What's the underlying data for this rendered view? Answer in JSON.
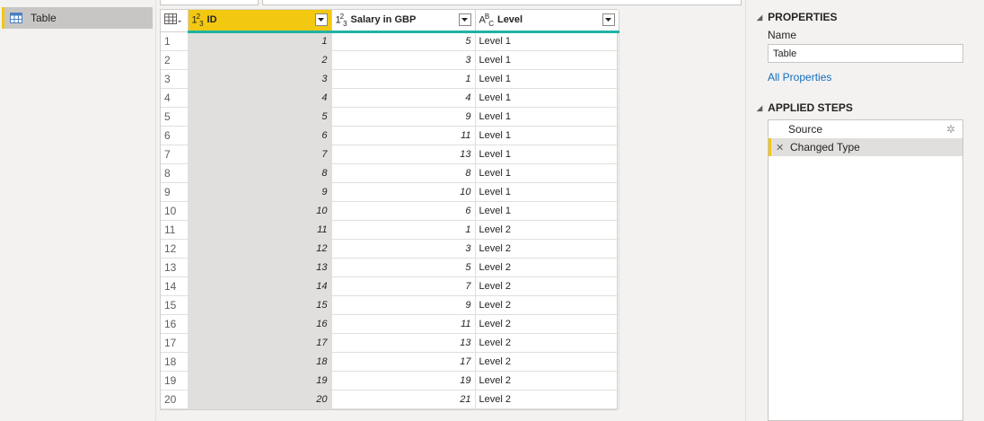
{
  "queries": {
    "items": [
      {
        "label": "Table"
      }
    ]
  },
  "grid": {
    "columns": [
      {
        "label": "ID",
        "type_icon": "whole-number-icon"
      },
      {
        "label": "Salary in GBP",
        "type_icon": "whole-number-icon"
      },
      {
        "label": "Level",
        "type_icon": "text-type-icon"
      }
    ],
    "rows": [
      {
        "n": "1",
        "id": "1",
        "salary": "5",
        "level": "Level 1"
      },
      {
        "n": "2",
        "id": "2",
        "salary": "3",
        "level": "Level 1"
      },
      {
        "n": "3",
        "id": "3",
        "salary": "1",
        "level": "Level 1"
      },
      {
        "n": "4",
        "id": "4",
        "salary": "4",
        "level": "Level 1"
      },
      {
        "n": "5",
        "id": "5",
        "salary": "9",
        "level": "Level 1"
      },
      {
        "n": "6",
        "id": "6",
        "salary": "11",
        "level": "Level 1"
      },
      {
        "n": "7",
        "id": "7",
        "salary": "13",
        "level": "Level 1"
      },
      {
        "n": "8",
        "id": "8",
        "salary": "8",
        "level": "Level 1"
      },
      {
        "n": "9",
        "id": "9",
        "salary": "10",
        "level": "Level 1"
      },
      {
        "n": "10",
        "id": "10",
        "salary": "6",
        "level": "Level 1"
      },
      {
        "n": "11",
        "id": "11",
        "salary": "1",
        "level": "Level 2"
      },
      {
        "n": "12",
        "id": "12",
        "salary": "3",
        "level": "Level 2"
      },
      {
        "n": "13",
        "id": "13",
        "salary": "5",
        "level": "Level 2"
      },
      {
        "n": "14",
        "id": "14",
        "salary": "7",
        "level": "Level 2"
      },
      {
        "n": "15",
        "id": "15",
        "salary": "9",
        "level": "Level 2"
      },
      {
        "n": "16",
        "id": "16",
        "salary": "11",
        "level": "Level 2"
      },
      {
        "n": "17",
        "id": "17",
        "salary": "13",
        "level": "Level 2"
      },
      {
        "n": "18",
        "id": "18",
        "salary": "17",
        "level": "Level 2"
      },
      {
        "n": "19",
        "id": "19",
        "salary": "19",
        "level": "Level 2"
      },
      {
        "n": "20",
        "id": "20",
        "salary": "21",
        "level": "Level 2"
      }
    ]
  },
  "properties": {
    "heading": "PROPERTIES",
    "name_label": "Name",
    "name_value": "Table",
    "all_properties": "All Properties"
  },
  "applied_steps": {
    "heading": "APPLIED STEPS",
    "steps": [
      {
        "label": "Source"
      },
      {
        "label": "Changed Type"
      }
    ]
  },
  "colors": {
    "accent": "#f2c811",
    "column_quality": "#1fb3a3",
    "link": "#106ebe"
  }
}
